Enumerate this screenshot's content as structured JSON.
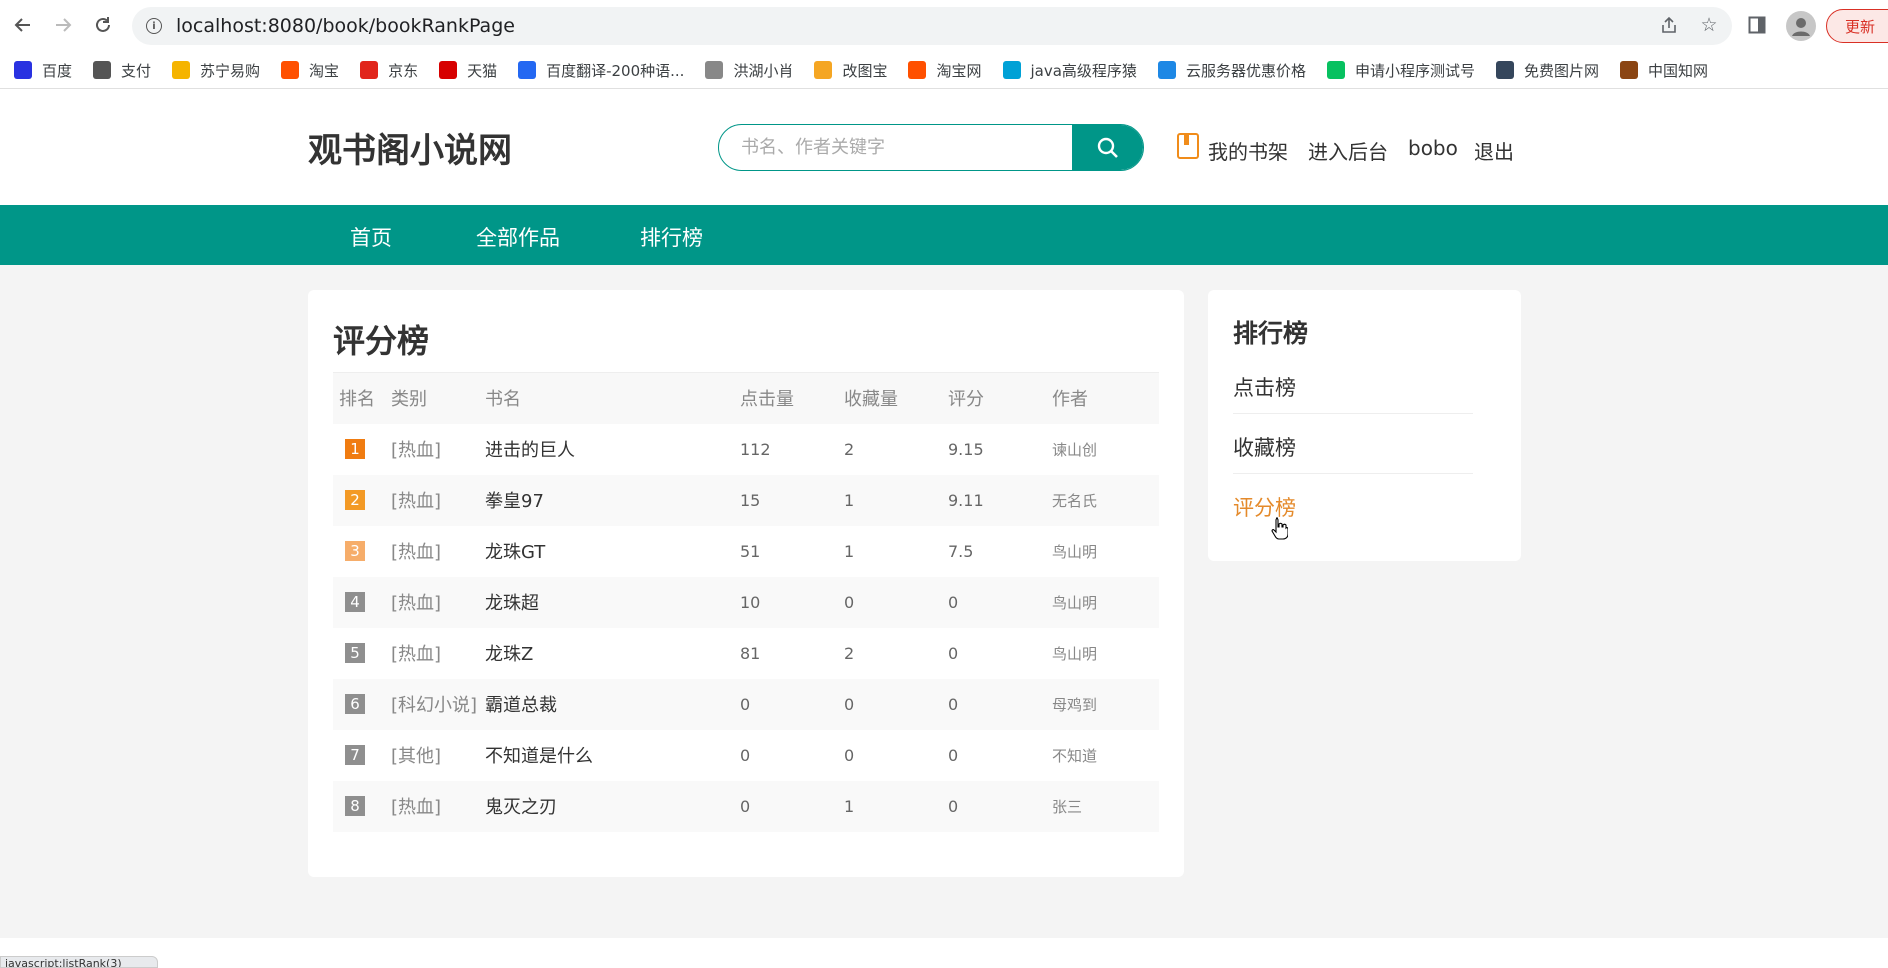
{
  "browser": {
    "url": "localhost:8080/book/bookRankPage",
    "update_label": "更新",
    "bookmarks": [
      {
        "label": "百度",
        "icon": "baidu-icon",
        "color": "#2932e1"
      },
      {
        "label": "支付",
        "icon": "globe-icon",
        "color": "#555555"
      },
      {
        "label": "苏宁易购",
        "icon": "suning-icon",
        "color": "#f5b400"
      },
      {
        "label": "淘宝",
        "icon": "taobao-icon",
        "color": "#ff5000"
      },
      {
        "label": "京东",
        "icon": "jd-icon",
        "color": "#e1251b"
      },
      {
        "label": "天猫",
        "icon": "tmall-icon",
        "color": "#d70000"
      },
      {
        "label": "百度翻译-200种语...",
        "icon": "translate-icon",
        "color": "#2468f2"
      },
      {
        "label": "洪湖小肖",
        "icon": "feather-icon",
        "color": "#888888"
      },
      {
        "label": "改图宝",
        "icon": "gaitubao-icon",
        "color": "#f5a623"
      },
      {
        "label": "淘宝网",
        "icon": "taobao-icon",
        "color": "#ff5000"
      },
      {
        "label": "java高级程序猿",
        "icon": "bilibili-icon",
        "color": "#00a1d6"
      },
      {
        "label": "云服务器优惠价格",
        "icon": "cloud-icon",
        "color": "#1e88e5"
      },
      {
        "label": "申请小程序测试号",
        "icon": "wechat-icon",
        "color": "#07c160"
      },
      {
        "label": "免费图片网",
        "icon": "tumblr-icon",
        "color": "#35465c"
      },
      {
        "label": "中国知网",
        "icon": "cnki-icon",
        "color": "#8b4513"
      }
    ],
    "status_text": "javascript:listRank(3)"
  },
  "header": {
    "logo": "观书阁小说网",
    "search_placeholder": "书名、作者关键字",
    "bookshelf": "我的书架",
    "admin": "进入后台",
    "username": "bobo",
    "logout": "退出"
  },
  "nav": {
    "home": "首页",
    "all_works": "全部作品",
    "rankings": "排行榜"
  },
  "colors": {
    "primary": "#009688",
    "accent": "#e48a2b",
    "rank1": "#f07c11",
    "rank2": "#f39a26",
    "rank3": "#f6ad6a",
    "rank_other": "#8f8f8f"
  },
  "main": {
    "title": "评分榜",
    "columns": [
      "排名",
      "类别",
      "书名",
      "点击量",
      "收藏量",
      "评分",
      "作者"
    ],
    "rows": [
      {
        "rank": "1",
        "category": "[热血]",
        "name": "进击的巨人",
        "clicks": "112",
        "favorites": "2",
        "score": "9.15",
        "author": "谏山创"
      },
      {
        "rank": "2",
        "category": "[热血]",
        "name": "拳皇97",
        "clicks": "15",
        "favorites": "1",
        "score": "9.11",
        "author": "无名氏"
      },
      {
        "rank": "3",
        "category": "[热血]",
        "name": "龙珠GT",
        "clicks": "51",
        "favorites": "1",
        "score": "7.5",
        "author": "鸟山明"
      },
      {
        "rank": "4",
        "category": "[热血]",
        "name": "龙珠超",
        "clicks": "10",
        "favorites": "0",
        "score": "0",
        "author": "鸟山明"
      },
      {
        "rank": "5",
        "category": "[热血]",
        "name": "龙珠Z",
        "clicks": "81",
        "favorites": "2",
        "score": "0",
        "author": "鸟山明"
      },
      {
        "rank": "6",
        "category": "[科幻小说]",
        "name": "霸道总裁",
        "clicks": "0",
        "favorites": "0",
        "score": "0",
        "author": "母鸡到"
      },
      {
        "rank": "7",
        "category": "[其他]",
        "name": "不知道是什么",
        "clicks": "0",
        "favorites": "0",
        "score": "0",
        "author": "不知道"
      },
      {
        "rank": "8",
        "category": "[热血]",
        "name": "鬼灭之刃",
        "clicks": "0",
        "favorites": "1",
        "score": "0",
        "author": "张三"
      }
    ]
  },
  "side": {
    "title": "排行榜",
    "items": [
      "点击榜",
      "收藏榜",
      "评分榜"
    ],
    "active_index": 2
  }
}
